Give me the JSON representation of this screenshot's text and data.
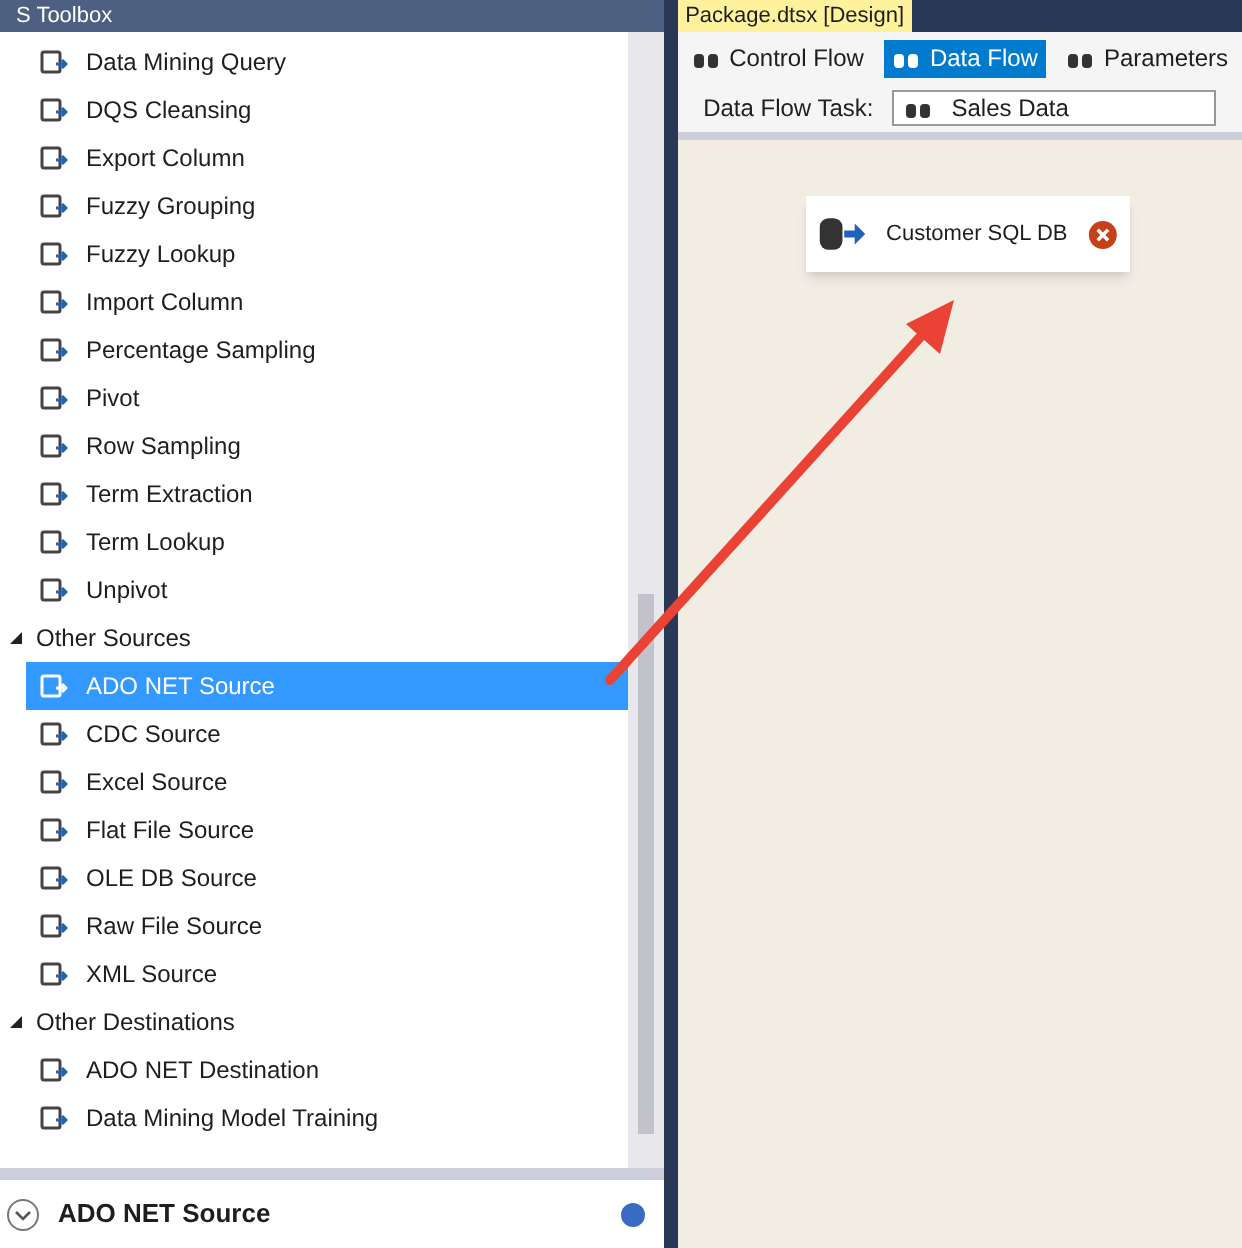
{
  "toolbox": {
    "title": "S Toolbox",
    "sections": [
      {
        "items": [
          {
            "label": "Data Mining Query",
            "selected": false
          },
          {
            "label": "DQS Cleansing",
            "selected": false
          },
          {
            "label": "Export Column",
            "selected": false
          },
          {
            "label": "Fuzzy Grouping",
            "selected": false
          },
          {
            "label": "Fuzzy Lookup",
            "selected": false
          },
          {
            "label": "Import Column",
            "selected": false
          },
          {
            "label": "Percentage Sampling",
            "selected": false
          },
          {
            "label": "Pivot",
            "selected": false
          },
          {
            "label": "Row Sampling",
            "selected": false
          },
          {
            "label": "Term Extraction",
            "selected": false
          },
          {
            "label": "Term Lookup",
            "selected": false
          },
          {
            "label": "Unpivot",
            "selected": false
          }
        ]
      },
      {
        "label": "Other Sources",
        "expanded": true,
        "items": [
          {
            "label": "ADO NET Source",
            "selected": true
          },
          {
            "label": "CDC Source",
            "selected": false
          },
          {
            "label": "Excel Source",
            "selected": false
          },
          {
            "label": "Flat File Source",
            "selected": false
          },
          {
            "label": "OLE DB Source",
            "selected": false
          },
          {
            "label": "Raw File Source",
            "selected": false
          },
          {
            "label": "XML Source",
            "selected": false
          }
        ]
      },
      {
        "label": "Other Destinations",
        "expanded": true,
        "items": [
          {
            "label": "ADO NET Destination",
            "selected": false
          },
          {
            "label": "Data Mining Model Training",
            "selected": false
          }
        ]
      }
    ],
    "footer": {
      "title": "ADO NET Source"
    }
  },
  "designer": {
    "document_tab": "Package.dtsx [Design]",
    "tabs": [
      {
        "label": "Control Flow",
        "selected": false
      },
      {
        "label": "Data Flow",
        "selected": true
      },
      {
        "label": "Parameters",
        "selected": false
      }
    ],
    "task_label": "Data Flow Task:",
    "task_value": "Sales Data",
    "nodes": [
      {
        "label": "Customer SQL DB",
        "error": true
      }
    ]
  }
}
